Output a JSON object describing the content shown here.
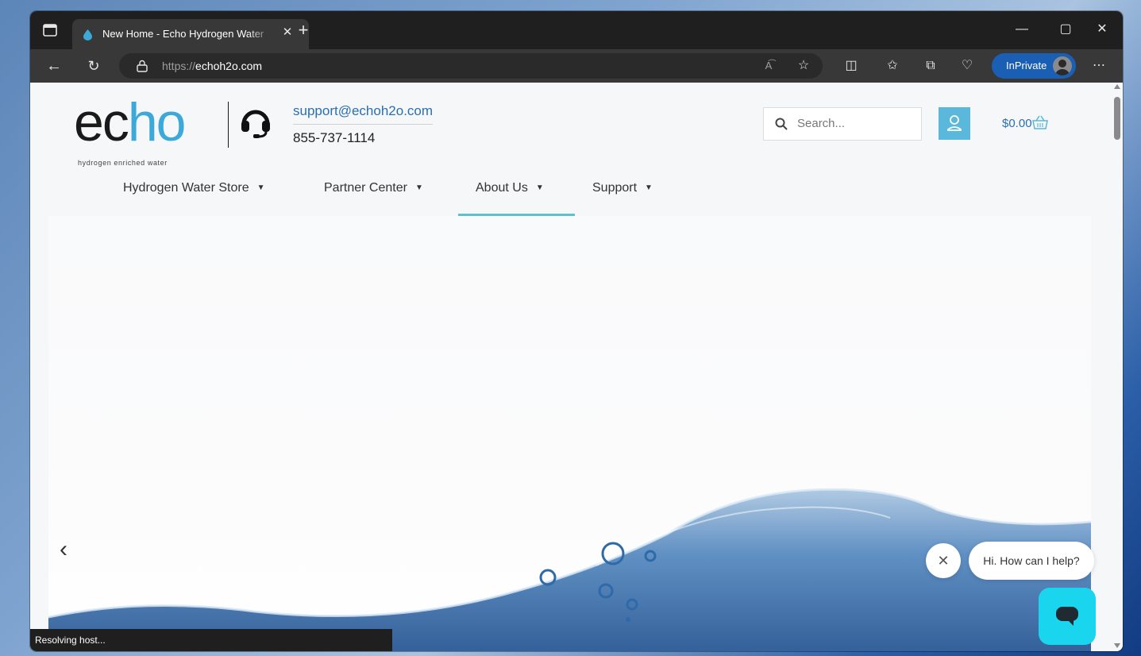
{
  "browser": {
    "tab_title": "New Home - Echo Hydrogen Water",
    "url_scheme": "https://",
    "url_host": "echoh2o.com",
    "inprivate_label": "InPrivate",
    "status_text": "Resolving host..."
  },
  "header": {
    "logo_text_dark": "ec",
    "logo_text_accent": "ho",
    "logo_tagline": "hydrogen enriched water",
    "email": "support@echoh2o.com",
    "phone": "855-737-1114",
    "search_placeholder": "Search...",
    "cart_total": "$0.00"
  },
  "nav": {
    "items": [
      {
        "label": "Hydrogen Water Store"
      },
      {
        "label": "Partner Center"
      },
      {
        "label": "About Us"
      },
      {
        "label": "Support"
      }
    ]
  },
  "chat": {
    "greeting": "Hi. How can I help?"
  },
  "colors": {
    "accent": "#3ca9d9",
    "nav_active_underline": "#5ec1cf",
    "chat_launcher": "#19d6ee",
    "inprivate": "#1a5fb4"
  }
}
